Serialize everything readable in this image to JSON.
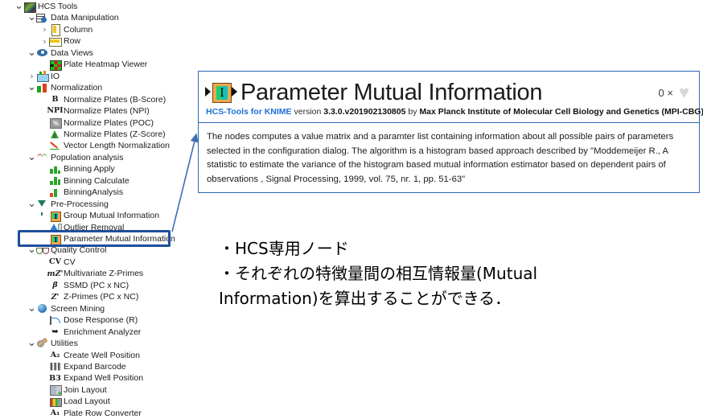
{
  "tree": {
    "name": "hcs-tools-node-repository",
    "rows": [
      {
        "depth": 0,
        "twisty": "open",
        "icon": "hcs-tools-icon",
        "label": "HCS Tools"
      },
      {
        "depth": 1,
        "twisty": "open",
        "icon": "data-manipulation-icon",
        "label": "Data Manipulation"
      },
      {
        "depth": 2,
        "twisty": "closed",
        "icon": "column-icon",
        "label": "Column"
      },
      {
        "depth": 2,
        "twisty": "closed",
        "icon": "row-icon",
        "label": "Row"
      },
      {
        "depth": 1,
        "twisty": "open",
        "icon": "data-views-eye-icon",
        "label": "Data Views"
      },
      {
        "depth": 2,
        "twisty": "none",
        "icon": "plate-heatmap-icon",
        "label": "Plate Heatmap Viewer"
      },
      {
        "depth": 1,
        "twisty": "closed",
        "icon": "io-icon",
        "label": "IO"
      },
      {
        "depth": 1,
        "twisty": "open",
        "icon": "normalization-icon",
        "label": "Normalization"
      },
      {
        "depth": 2,
        "twisty": "none",
        "icon": "b-score-icon",
        "label": "Normalize Plates (B-Score)"
      },
      {
        "depth": 2,
        "twisty": "none",
        "icon": "npi-icon",
        "label": "Normalize Plates (NPI)"
      },
      {
        "depth": 2,
        "twisty": "none",
        "icon": "poc-percent-icon",
        "label": "Normalize Plates (POC)"
      },
      {
        "depth": 2,
        "twisty": "none",
        "icon": "z-score-bell-icon",
        "label": "Normalize Plates (Z-Score)"
      },
      {
        "depth": 2,
        "twisty": "none",
        "icon": "vector-length-icon",
        "label": "Vector Length Normalization"
      },
      {
        "depth": 1,
        "twisty": "open",
        "icon": "population-analysis-icon",
        "label": "Population analysis"
      },
      {
        "depth": 2,
        "twisty": "none",
        "icon": "binning-apply-icon",
        "label": "Binning Apply"
      },
      {
        "depth": 2,
        "twisty": "none",
        "icon": "binning-calculate-icon",
        "label": "Binning Calculate"
      },
      {
        "depth": 2,
        "twisty": "none",
        "icon": "binning-analysis-icon",
        "label": "BinningAnalysis"
      },
      {
        "depth": 1,
        "twisty": "open",
        "icon": "pre-processing-funnel-icon",
        "label": "Pre-Processing"
      },
      {
        "depth": 2,
        "twisty": "none",
        "icon": "mutual-information-node-icon",
        "label": "Group Mutual Information"
      },
      {
        "depth": 2,
        "twisty": "none",
        "icon": "outlier-removal-icon",
        "label": "Outlier Removal"
      },
      {
        "depth": 2,
        "twisty": "none",
        "icon": "mutual-information-node-icon",
        "label": "Parameter Mutual Information",
        "selected": true
      },
      {
        "depth": 1,
        "twisty": "open",
        "icon": "quality-control-icon",
        "label": "Quality Control"
      },
      {
        "depth": 2,
        "twisty": "none",
        "icon": "cv-icon",
        "label": "CV"
      },
      {
        "depth": 2,
        "twisty": "none",
        "icon": "multivariate-z-primes-icon",
        "label": "Multivariate Z-Primes"
      },
      {
        "depth": 2,
        "twisty": "none",
        "icon": "ssmd-beta-icon",
        "label": "SSMD (PC x NC)"
      },
      {
        "depth": 2,
        "twisty": "none",
        "icon": "z-primes-icon",
        "label": "Z-Primes (PC x NC)"
      },
      {
        "depth": 1,
        "twisty": "open",
        "icon": "screen-mining-icon",
        "label": "Screen Mining"
      },
      {
        "depth": 2,
        "twisty": "none",
        "icon": "dose-response-icon",
        "label": "Dose Response (R)"
      },
      {
        "depth": 2,
        "twisty": "none",
        "icon": "enrichment-analyzer-icon",
        "label": "Enrichment Analyzer"
      },
      {
        "depth": 1,
        "twisty": "open",
        "icon": "utilities-wrench-icon",
        "label": "Utilities"
      },
      {
        "depth": 2,
        "twisty": "none",
        "icon": "create-well-position-icon",
        "label": "Create Well Position"
      },
      {
        "depth": 2,
        "twisty": "none",
        "icon": "expand-barcode-icon",
        "label": "Expand Barcode"
      },
      {
        "depth": 2,
        "twisty": "none",
        "icon": "expand-well-position-icon",
        "label": "Expand Well Position"
      },
      {
        "depth": 2,
        "twisty": "none",
        "icon": "join-layout-icon",
        "label": "Join Layout"
      },
      {
        "depth": 2,
        "twisty": "none",
        "icon": "load-layout-icon",
        "label": "Load Layout"
      },
      {
        "depth": 2,
        "twisty": "none",
        "icon": "plate-row-converter-icon",
        "label": "Plate Row Converter"
      }
    ],
    "glyph_icons": {
      "b-score-icon": "B",
      "npi-icon": "NPI",
      "cv-icon": "CV",
      "multivariate-z-primes-icon": "mZ'",
      "ssmd-beta-icon": "β",
      "z-primes-icon": "Z'",
      "enrichment-analyzer-icon": "➥",
      "create-well-position-icon": "A₂",
      "expand-barcode-icon": "‖‖‖",
      "expand-well-position-icon": "B3",
      "plate-row-converter-icon": "A₁",
      "poc-percent-icon": "%",
      "mutual-information-node-icon": "I"
    }
  },
  "selection": {
    "name": "parameter-mutual-information-highlight",
    "border_color": "#1f4e9c"
  },
  "callout": {
    "name": "callout-arrow",
    "color": "#3b6fb6"
  },
  "panel": {
    "title": "Parameter Mutual Information",
    "node_icon_letter": "I",
    "favorite_count": "0 ×",
    "heart": "♥",
    "subtitle": {
      "link": "HCS-Tools for KNIME",
      "version_word": "version",
      "version": "3.3.0.v201902130805",
      "by_word": "by",
      "vendor": "Max Planck Institute of Molecular Cell Biology and Genetics (MPI-CBG)"
    },
    "description": "The nodes computes a value matrix and a paramter list containing information about all possible pairs of parameters selected in the configuration dialog. The algorithm is a histogram based approach described by \"Moddemeijer R., A statistic to estimate the variance of the histogram based mutual information estimator based on dependent pairs of observations , Signal Processing, 1999, vol. 75, nr. 1, pp. 51-63\"",
    "border_color": "#2e66b5",
    "link_color": "#1e6fd9"
  },
  "annotation": {
    "name": "japanese-annotation",
    "text": "・HCS専用ノード\n・それぞれの特徴量間の相互情報量(Mutual Information)を算出することができる．"
  }
}
